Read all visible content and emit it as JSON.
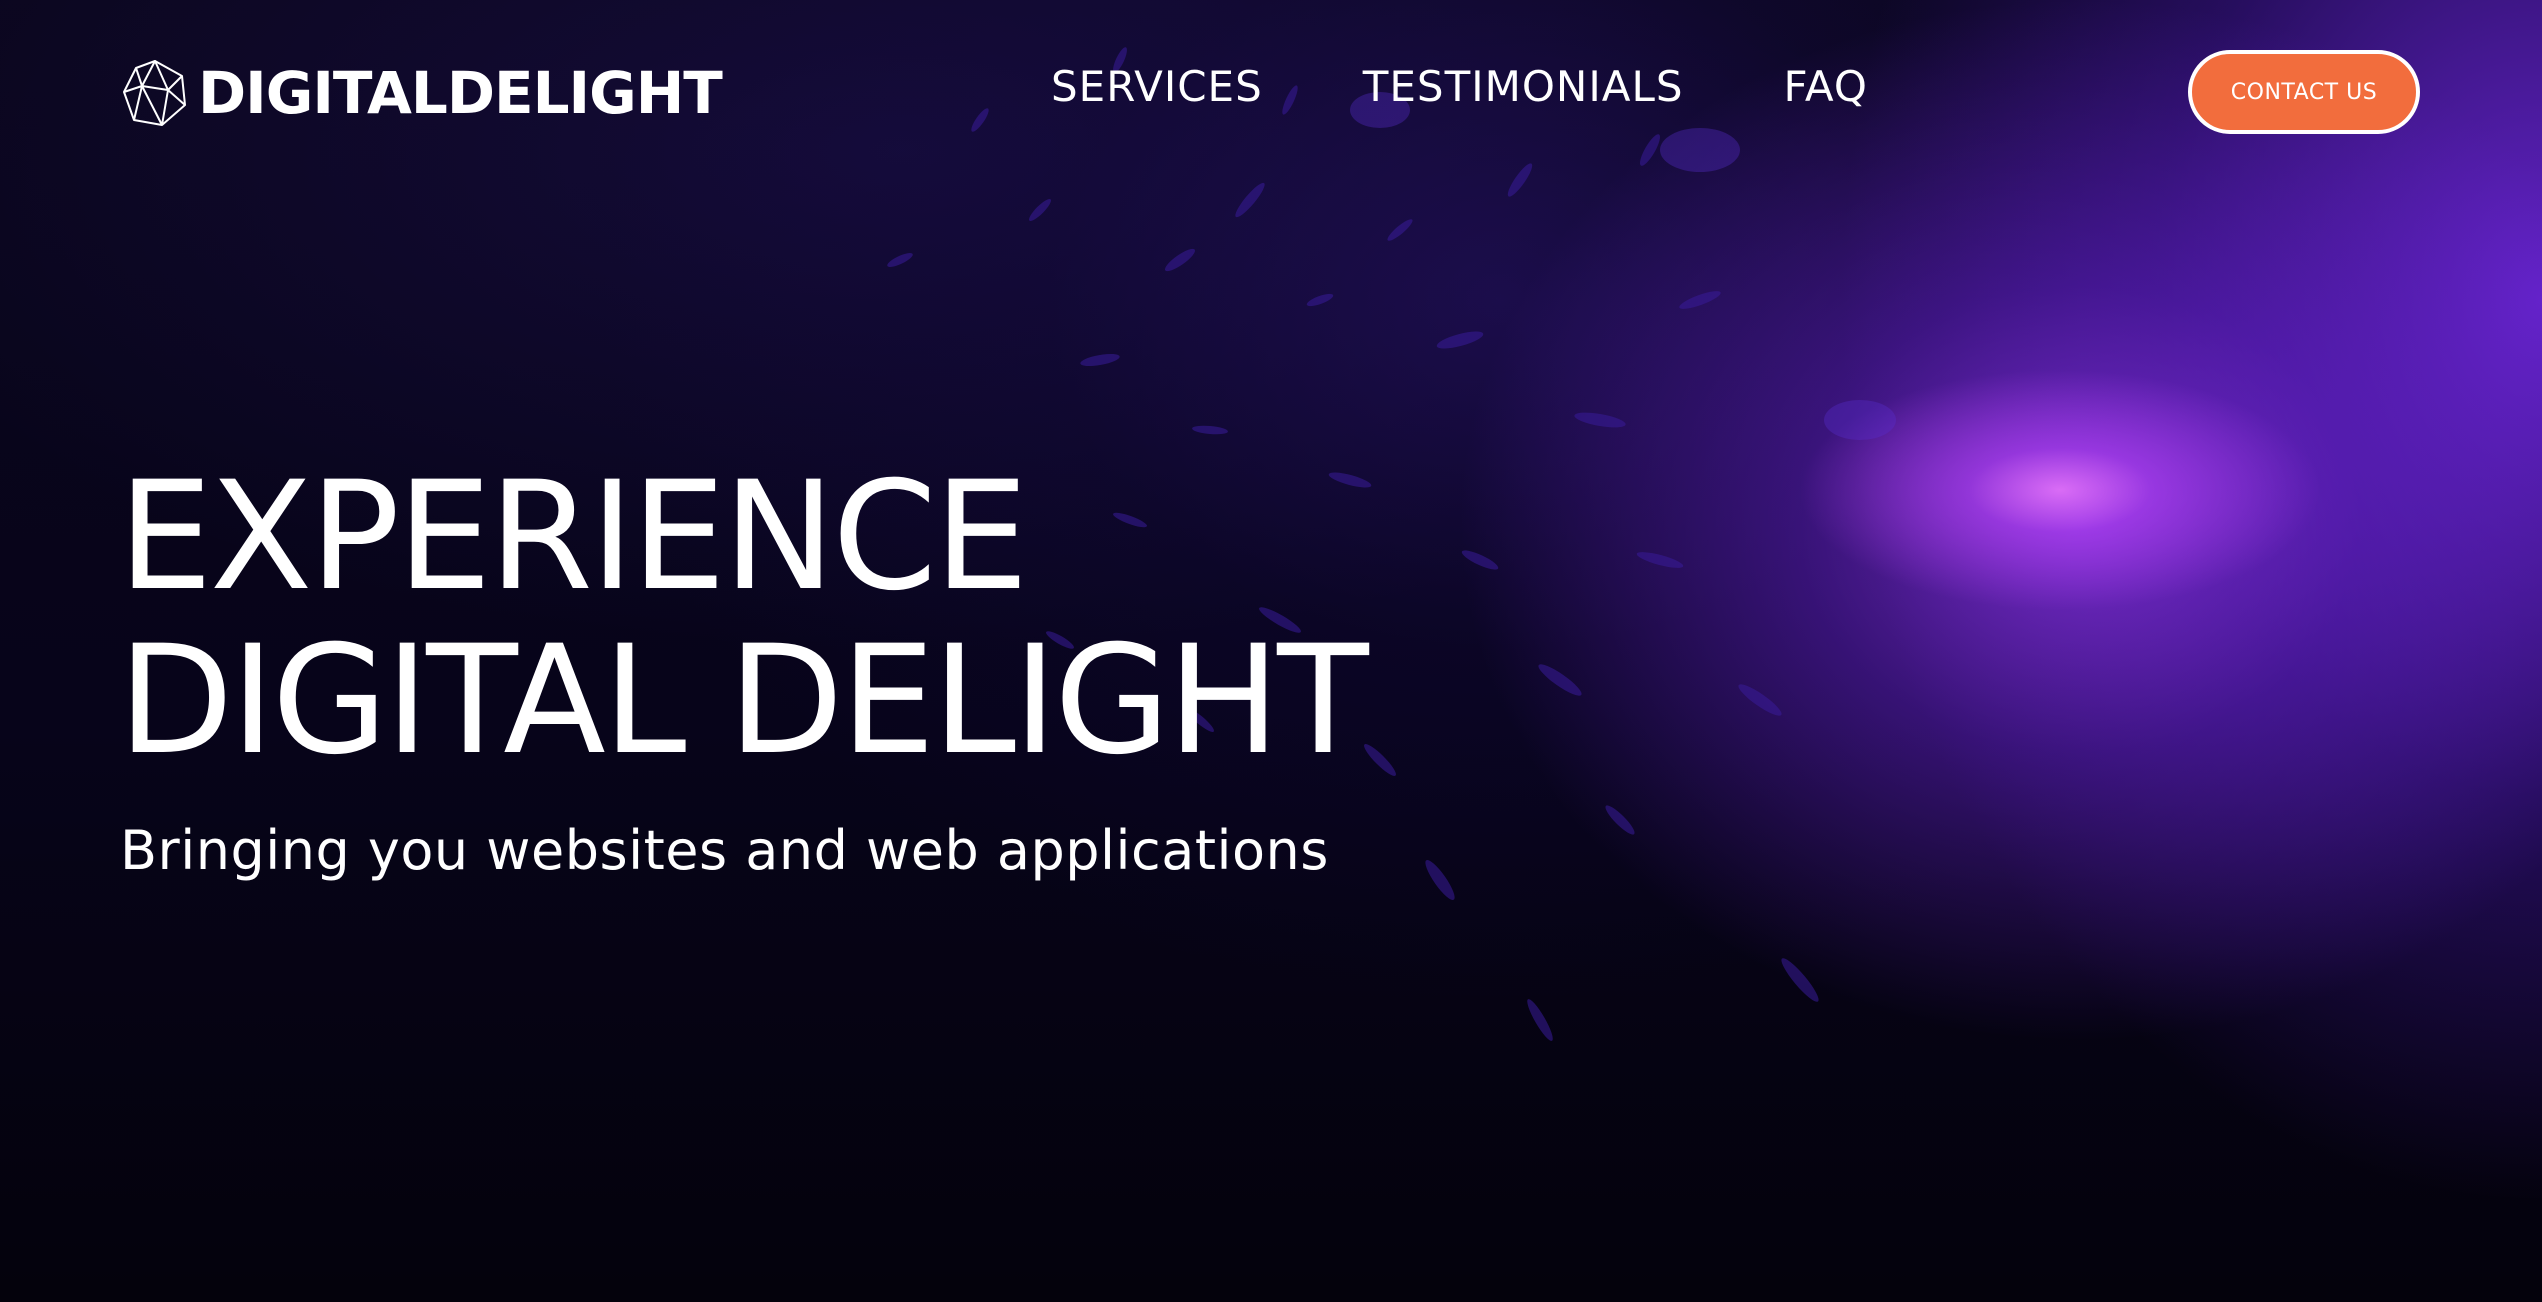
{
  "brand": {
    "logo_icon": "polyhedron-icon",
    "name": "DIGITALDELIGHT"
  },
  "nav": {
    "items": [
      {
        "label": "SERVICES"
      },
      {
        "label": "TESTIMONIALS"
      },
      {
        "label": "FAQ"
      }
    ]
  },
  "cta": {
    "label": "CONTACT US",
    "color": "#f26d3d"
  },
  "hero": {
    "title_line1": "EXPERIENCE",
    "title_line2": "DIGITAL DELIGHT",
    "subtitle": "Bringing you websites and web applications"
  },
  "theme": {
    "background": "#05030f",
    "accent_purple": "#9b3ff2"
  }
}
